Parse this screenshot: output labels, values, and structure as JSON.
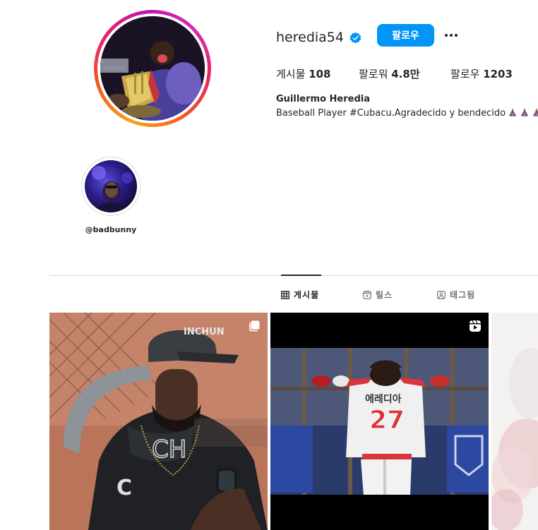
{
  "profile": {
    "username": "heredia54",
    "follow_label": "팔로우",
    "stats": {
      "posts_label": "게시물",
      "posts_value": "108",
      "followers_label": "팔로워",
      "followers_value": "4.8만",
      "following_label": "팔로우",
      "following_value": "1203"
    },
    "full_name": "Guillermo Heredia",
    "bio": "Baseball Player #Cubacu.Agradecido y bendecido"
  },
  "highlights": [
    {
      "label": "@badbunny"
    }
  ],
  "tabs": [
    {
      "label": "게시물",
      "icon": "grid-icon",
      "active": true
    },
    {
      "label": "릴스",
      "icon": "reels-icon",
      "active": false
    },
    {
      "label": "태그됨",
      "icon": "tagged-icon",
      "active": false
    }
  ],
  "posts": [
    {
      "type": "carousel",
      "icon": "carousel-icon",
      "cap_text": "INCHUN"
    },
    {
      "type": "reel",
      "icon": "reels-icon",
      "jersey_name": "에레디아",
      "jersey_number": "27"
    },
    {
      "type": "photo"
    }
  ],
  "colors": {
    "accent": "#0095f6",
    "verified": "#0095f6",
    "jersey_red": "#d8363a"
  }
}
